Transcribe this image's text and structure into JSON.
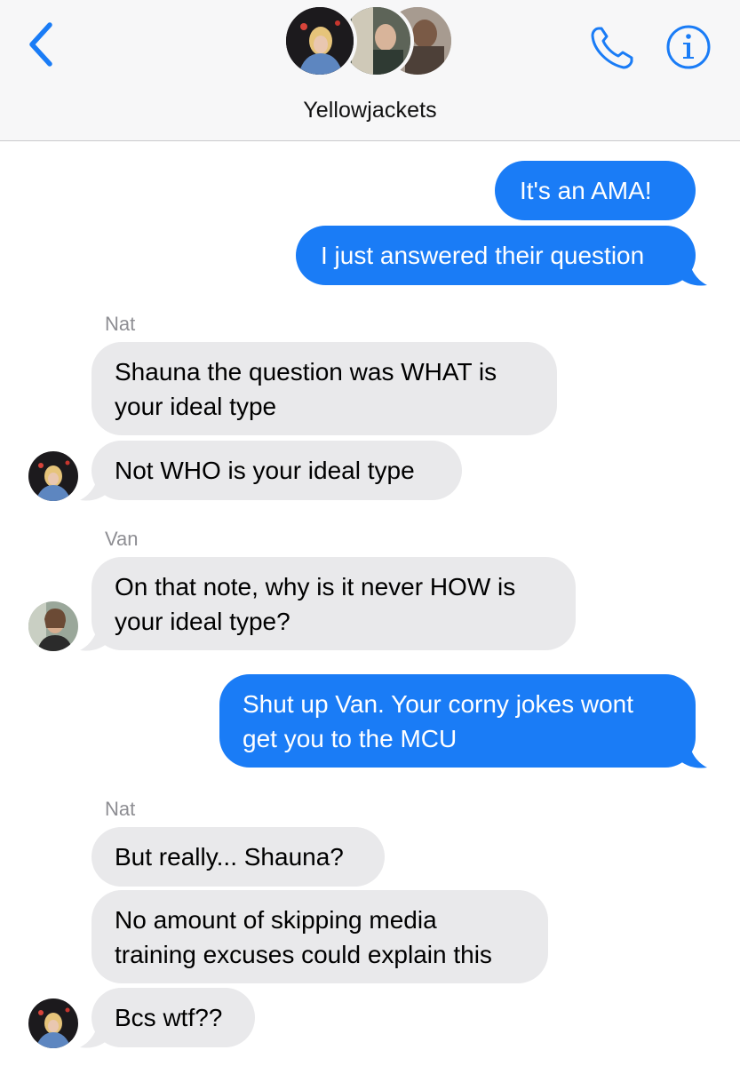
{
  "header": {
    "title": "Yellowjackets",
    "back_icon": "chevron-left-icon",
    "call_icon": "phone-icon",
    "info_icon": "info-icon",
    "accent_color": "#1a7cf6"
  },
  "messages": [
    {
      "direction": "outgoing",
      "text": "It's an AMA!"
    },
    {
      "direction": "outgoing",
      "text": "I just answered their question"
    },
    {
      "direction": "incoming",
      "sender": "Nat",
      "lines": [
        "Shauna the question was WHAT is",
        "your ideal type"
      ]
    },
    {
      "direction": "incoming",
      "text": "Not WHO is your ideal type"
    },
    {
      "direction": "incoming",
      "sender": "Van",
      "lines": [
        "On that note, why is it never HOW is",
        "your ideal type?"
      ]
    },
    {
      "direction": "outgoing",
      "lines": [
        "Shut up Van. Your corny jokes wont",
        "get you to the MCU"
      ]
    },
    {
      "direction": "incoming",
      "sender": "Nat",
      "text": "But really... Shauna?"
    },
    {
      "direction": "incoming",
      "lines": [
        "No amount of skipping media",
        "training excuses could explain this"
      ]
    },
    {
      "direction": "incoming",
      "text": "Bcs wtf??"
    }
  ],
  "colors": {
    "outgoing_bubble": "#1a7cf6",
    "incoming_bubble": "#e9e9eb",
    "sender_label": "#8e8e93"
  }
}
